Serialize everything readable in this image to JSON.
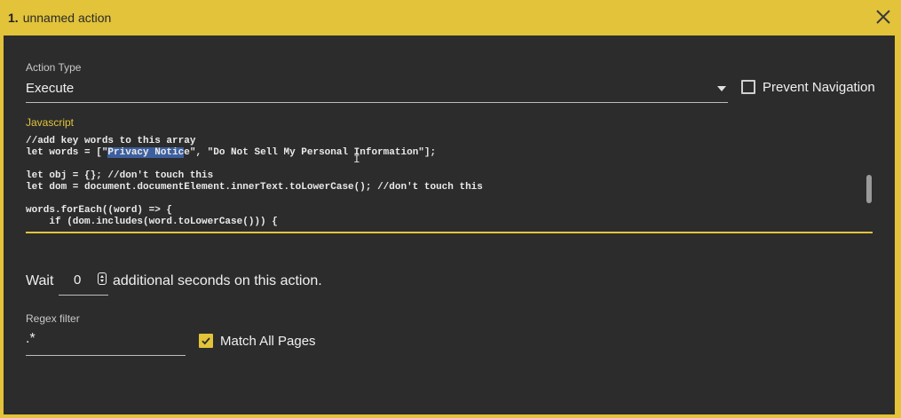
{
  "titlebar": {
    "number": "1.",
    "title": "unnamed action"
  },
  "action_type": {
    "label": "Action Type",
    "value": "Execute"
  },
  "prevent_navigation": {
    "label": "Prevent Navigation",
    "checked": false
  },
  "javascript": {
    "label": "Javascript",
    "lines": [
      "//add key words to this array",
      "let words = [\"Privacy Notice\", \"Do Not Sell My Personal Information\"];",
      "",
      "let obj = {}; //don't touch this",
      "let dom = document.documentElement.innerText.toLowerCase(); //don't touch this",
      "",
      "words.forEach((word) => {",
      "    if (dom.includes(word.toLowerCase())) {"
    ],
    "selected_text": "Privacy Notic"
  },
  "wait": {
    "prefix": "Wait",
    "value": "0",
    "suffix": "additional seconds on this action."
  },
  "regex_filter": {
    "label": "Regex filter",
    "value": ".*"
  },
  "match_all_pages": {
    "label": "Match All Pages",
    "checked": true
  },
  "colors": {
    "accent": "#e2c33a",
    "panel": "#2c2c2c",
    "selection": "#3d5f9e"
  }
}
